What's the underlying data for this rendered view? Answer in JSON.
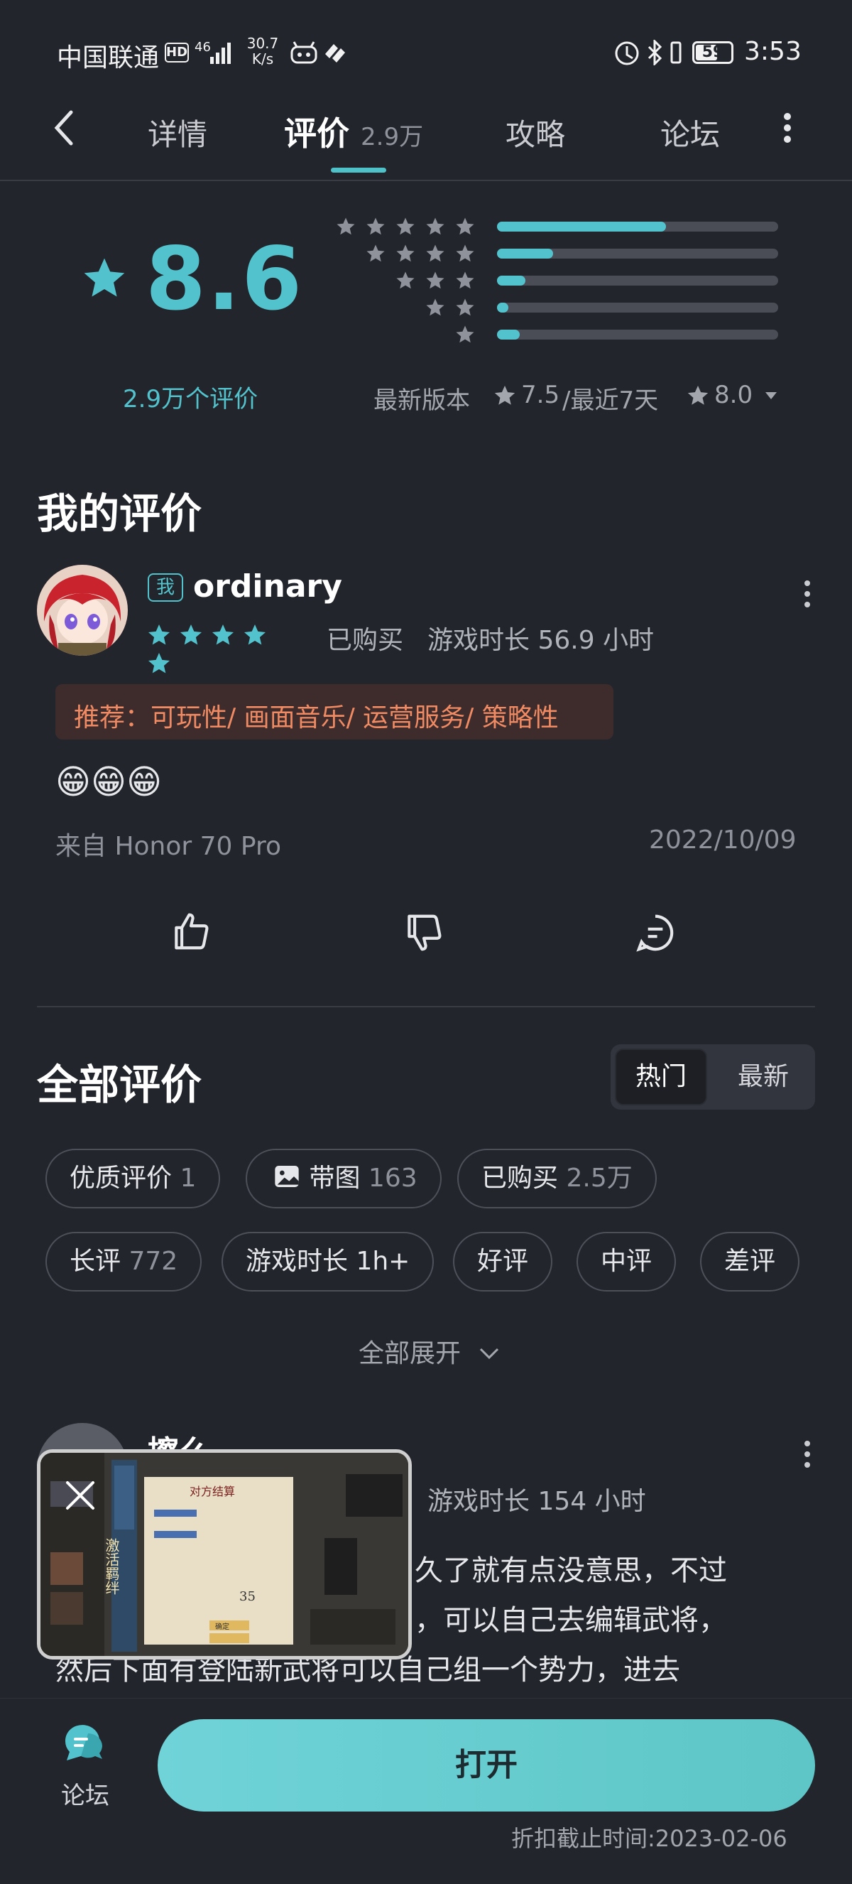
{
  "status_bar": {
    "carrier": "中国联通",
    "hd": "HD",
    "network": "46",
    "speed_value": "30.7",
    "speed_unit": "K/s",
    "battery": "59",
    "time": "3:53"
  },
  "nav": {
    "tabs": [
      {
        "label": "详情"
      },
      {
        "label": "评价",
        "count": "2.9万"
      },
      {
        "label": "攻略"
      },
      {
        "label": "论坛"
      }
    ],
    "active_tab": "评价"
  },
  "rating": {
    "score": "8.6",
    "count_text": "2.9万个评价",
    "distribution": [
      {
        "stars": 5,
        "fraction": 0.6
      },
      {
        "stars": 4,
        "fraction": 0.2
      },
      {
        "stars": 3,
        "fraction": 0.1
      },
      {
        "stars": 2,
        "fraction": 0.04
      },
      {
        "stars": 1,
        "fraction": 0.08
      }
    ],
    "latest_version_label": "最新版本",
    "latest_version_score": "7.5",
    "recent_label": "/最近7天",
    "recent_score": "8.0"
  },
  "my_review": {
    "title": "我的评价",
    "badge": "我",
    "username": "ordinary",
    "stars": 5,
    "purchased": "已购买",
    "playtime": "游戏时长 56.9 小时",
    "tags": "推荐：可玩性/ 画面音乐/ 运营服务/ 策略性",
    "content": "😁😁😁",
    "device": "来自 Honor 70 Pro",
    "date": "2022/10/09"
  },
  "all_reviews": {
    "title": "全部评价",
    "sort_hot": "热门",
    "sort_new": "最新",
    "filters": [
      {
        "label": "优质评价",
        "count": "1"
      },
      {
        "label": "带图",
        "count": "163"
      },
      {
        "label": "已购买",
        "count": "2.5万"
      },
      {
        "label": "长评",
        "count": "772"
      },
      {
        "label": "游戏时长 1h+",
        "count": ""
      },
      {
        "label": "好评",
        "count": ""
      },
      {
        "label": "中评",
        "count": ""
      },
      {
        "label": "差评",
        "count": ""
      }
    ],
    "expand": "全部展开"
  },
  "review": {
    "username": "擦么",
    "playtime": "游戏时长 154 小时",
    "line1": "久了就有点没意思，不过",
    "line2": "，可以自己去编辑武将，",
    "line3": "然后下面有登陆新武将可以自己组一个势力，进去"
  },
  "video_overlay": {
    "panel_title": "对方结算",
    "banner": "激活羁绊",
    "stat_value": "35",
    "confirm": "确定"
  },
  "bottom": {
    "forum_label": "论坛",
    "open_button": "打开",
    "discount_text": "折扣截止时间:2023-02-06"
  },
  "colors": {
    "background": "#23252d",
    "accent": "#52c3cc",
    "tag_text": "#f08a62"
  }
}
